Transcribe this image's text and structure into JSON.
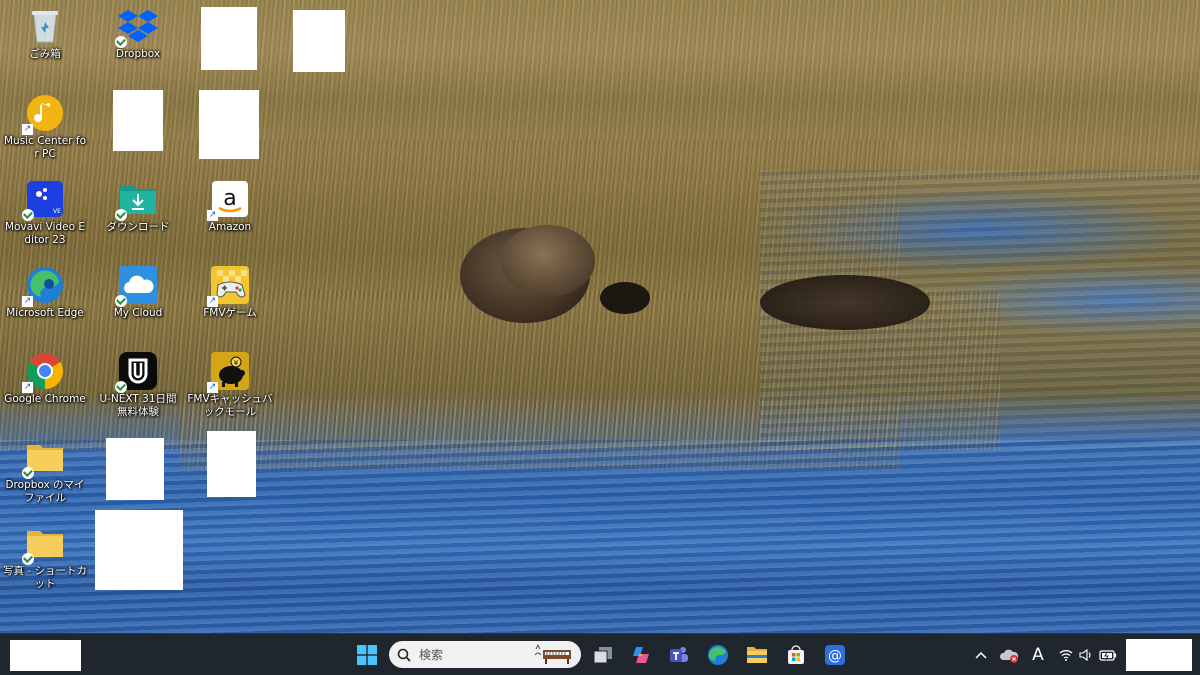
{
  "desktop": {
    "icons": [
      {
        "id": "recycle-bin",
        "label": "ごみ箱",
        "icon": "recycle-bin-icon"
      },
      {
        "id": "dropbox",
        "label": "Dropbox",
        "icon": "dropbox-icon"
      },
      {
        "id": "music-center",
        "label": "Music Center for PC",
        "icon": "music-note-icon"
      },
      {
        "id": "movavi",
        "label": "Movavi Video Editor 23",
        "icon": "movavi-icon"
      },
      {
        "id": "downloads",
        "label": "ダウンロード",
        "icon": "download-folder-icon"
      },
      {
        "id": "amazon",
        "label": "Amazon",
        "icon": "amazon-icon"
      },
      {
        "id": "edge",
        "label": "Microsoft Edge",
        "icon": "edge-icon"
      },
      {
        "id": "mycloud",
        "label": "My Cloud",
        "icon": "cloud-icon"
      },
      {
        "id": "fmv-game",
        "label": "FMVゲーム",
        "icon": "gamepad-icon"
      },
      {
        "id": "chrome",
        "label": "Google Chrome",
        "icon": "chrome-icon"
      },
      {
        "id": "unext",
        "label": "U-NEXT 31日間無料体験",
        "icon": "unext-icon"
      },
      {
        "id": "fmv-cashback",
        "label": "FMVキャッシュバックモール",
        "icon": "piggy-bank-icon"
      },
      {
        "id": "dropbox-files",
        "label": "Dropbox のマイファイル",
        "icon": "folder-icon"
      },
      {
        "id": "photos-shortcut",
        "label": "写真 - ショートカット",
        "icon": "folder-icon"
      }
    ]
  },
  "taskbar": {
    "search_placeholder": "検索",
    "ime_indicator": "A",
    "pinned": [
      "start-button",
      "search",
      "task-view",
      "copilot",
      "teams",
      "edge",
      "file-explorer",
      "microsoft-store",
      "mail"
    ],
    "accent": "#20262e"
  }
}
